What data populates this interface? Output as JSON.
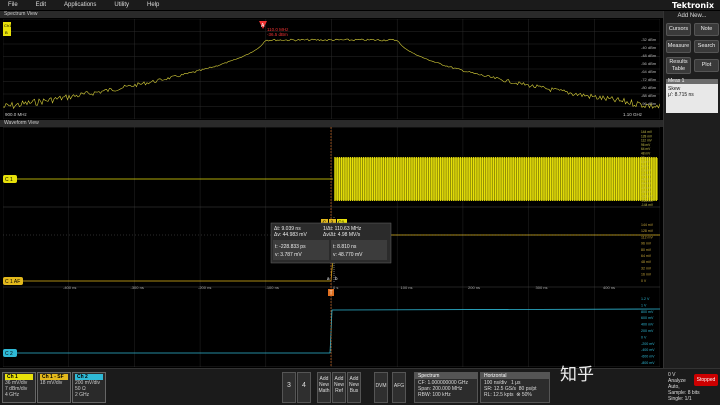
{
  "menu": [
    "File",
    "Edit",
    "Applications",
    "Utility",
    "Help"
  ],
  "brand": "Tektronix",
  "right_panel": {
    "add_new": "Add New...",
    "buttons": [
      "Cursors",
      "Note",
      "Measure",
      "Search",
      "Results Table",
      "Plot"
    ],
    "meas_title": "Meas 1",
    "meas_name": "Skew",
    "meas_value": "μ': 8.715 ns"
  },
  "spectrum": {
    "title": "Spectrum View",
    "marker_label": "A",
    "marker_readout_1": "110.0 MHz",
    "marker_readout_2": "-36.5 dBm",
    "left_freq": "900.0 MHz",
    "right_freq": "1.10 GHz",
    "left_label_1": "Ch1",
    "left_label_2": "B",
    "db_ticks": [
      "-32 dBm",
      "-40 dBm",
      "-48 dBm",
      "-56 dBm",
      "-64 dBm",
      "-72 dBm",
      "-80 dBm",
      "-88 dBm",
      "-96 dBm"
    ],
    "trace_color": "#d8d03a"
  },
  "waveform": {
    "title": "Waveform View",
    "time_ticks": [
      "-400 ns",
      "-300 ns",
      "-200 ns",
      "-100 ns",
      "0 s",
      "100 ns",
      "200 ns",
      "300 ns",
      "400 ns"
    ],
    "ch1_label": "C 1",
    "ch1_ticks": [
      "144 mV",
      "128 mV",
      "112 mV",
      "96 mV",
      "64 mV",
      "48 mV",
      "32 mV",
      "16 mV",
      "0 mV",
      "-16 mV",
      "-32 mV",
      "-48 mV",
      "-64 mV",
      "-80 mV",
      "-96 mV",
      "-112 mV",
      "-128 mV",
      "-144 mV"
    ],
    "math_label": "C 1 AF",
    "math_ticks": [
      "144 mV",
      "128 mV",
      "112 mV",
      "96 mV",
      "80 mV",
      "64 mV",
      "48 mV",
      "32 mV",
      "16 mV",
      "0 V"
    ],
    "ch2_label": "C 2",
    "ch2_ticks": [
      "1.2 V",
      "1 V",
      "800 mV",
      "600 mV",
      "400 mV",
      "200 mV",
      "0 V",
      "-200 mV",
      "-400 mV",
      "-600 mV",
      "-800 mV"
    ],
    "cursor_tags": [
      "C",
      "3",
      "C1"
    ],
    "cursor_a_label": "a",
    "cursor_b_label": "b",
    "trigger_label": "T",
    "cursor_box": {
      "dt": "Δt: 9.039 ns",
      "inv_dt": "1/Δt: 110.63 MHz",
      "dv": "Δv: 44.983 mV",
      "dv_dt": "Δv/Δt: 4.98 MV/s",
      "t1": "t: -228.833 ps",
      "v1": "v: 3.787 mV",
      "t2": "t: 8.810 ns",
      "v2": "v: 48.770 mV"
    },
    "ch1_color": "#e8e10a",
    "ch2_color": "#2fb9d6"
  },
  "bottom": {
    "ch1": {
      "title": "Ch 1",
      "l1": "36 mV/div",
      "l2": "7 dBm/div",
      "l3": "4 GHz",
      "color": "#e8e10a"
    },
    "ch1sf": {
      "title": "Ch 1 - SF",
      "l1": "18 mV/div",
      "color": "#e3b91c"
    },
    "ch2": {
      "title": "Ch 2",
      "l1": "200 mV/div",
      "l2": "50 Ω",
      "l3": "2 GHz",
      "color": "#2fb9d6"
    },
    "small_buttons": [
      "3",
      "4",
      "Add New Math",
      "Add New Ref",
      "Add New Bus",
      "DVM",
      "AFG"
    ],
    "spectrum": {
      "head": "Spectrum",
      "l1": "CF: 1.000000000 GHz",
      "l2": "Span: 200.000 MHz",
      "l3": "RBW: 100 kHz"
    },
    "horizontal": {
      "head": "Horizontal",
      "l1": "100 ns/div",
      "l2": "1 μs",
      "l3": "SR: 12.5 GS/s",
      "l4": "80 ps/pt",
      "l5": "RL: 12.5 kpts",
      "l6": "⊗ 50%"
    },
    "trigger_l1": "0 V",
    "acq_l1": "Analyze",
    "acq_l2": "Auto,",
    "acq_l3": "Sample: 8 bits",
    "acq_l4": "Single: 1/1",
    "stop": "Stopped",
    "watermark": "知乎"
  }
}
